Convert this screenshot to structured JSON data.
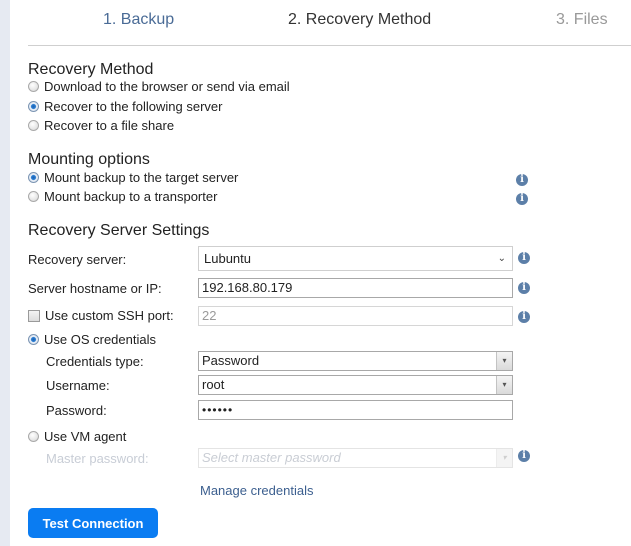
{
  "wizard": {
    "steps": [
      {
        "label": "1. Backup",
        "state": "completed"
      },
      {
        "label": "2. Recovery Method",
        "state": "current"
      },
      {
        "label": "3. Files",
        "state": "upcoming"
      }
    ]
  },
  "recovery_method": {
    "title": "Recovery Method",
    "options": [
      {
        "label": "Download to the browser or send via email",
        "checked": false
      },
      {
        "label": "Recover to the following server",
        "checked": true
      },
      {
        "label": "Recover to a file share",
        "checked": false
      }
    ]
  },
  "mounting": {
    "title": "Mounting options",
    "options": [
      {
        "label": "Mount backup to the target server",
        "checked": true
      },
      {
        "label": "Mount backup to a transporter",
        "checked": false
      }
    ]
  },
  "server_settings": {
    "title": "Recovery Server Settings",
    "recovery_server": {
      "label": "Recovery server:",
      "value": "Lubuntu"
    },
    "hostname": {
      "label": "Server hostname or IP:",
      "value": "192.168.80.179"
    },
    "ssh_port": {
      "label": "Use custom SSH port:",
      "checked": false,
      "value": "22"
    },
    "os_credentials": {
      "label": "Use OS credentials",
      "checked": true,
      "credentials_type": {
        "label": "Credentials type:",
        "value": "Password"
      },
      "username": {
        "label": "Username:",
        "value": "root"
      },
      "password": {
        "label": "Password:",
        "value": "••••••"
      }
    },
    "vm_agent": {
      "label": "Use VM agent",
      "checked": false,
      "master_password": {
        "label": "Master password:",
        "placeholder": "Select master password"
      }
    },
    "manage_credentials_link": "Manage credentials"
  },
  "actions": {
    "test_connection": "Test Connection"
  },
  "icons": {
    "info": "i",
    "chevron": "⌄",
    "dropdown_arrow": "▾"
  },
  "colors": {
    "accent_button": "#0a7cf2",
    "link": "#3c5f8f",
    "info_icon": "#5c7fa8",
    "step_completed": "#4a6b96",
    "step_upcoming": "#999999"
  }
}
